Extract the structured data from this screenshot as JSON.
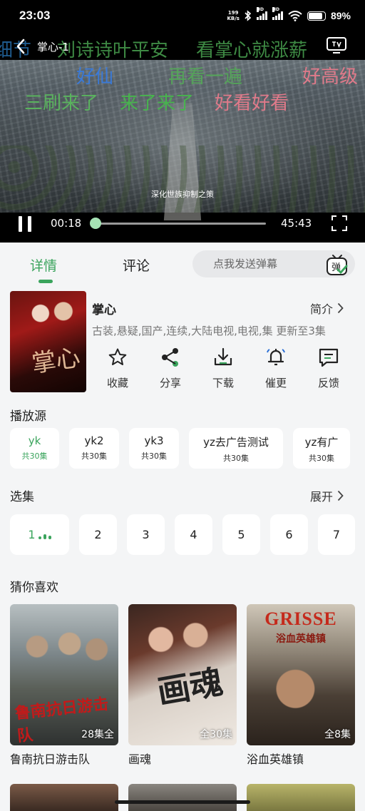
{
  "status_bar": {
    "time": "23:03",
    "net_speed_value": "199",
    "net_speed_unit": "KB/s",
    "hd1": "HD",
    "hd2": "HD",
    "battery": "89%"
  },
  "player": {
    "title": "掌心-1",
    "current_time": "00:18",
    "duration": "45:43",
    "progress": 0.0066,
    "caption": "深化世族抑制之策",
    "danmaku": [
      {
        "text": "细节",
        "color": "#1f5c8f"
      },
      {
        "text": "刘诗诗叶平安",
        "color": "#3e8a44"
      },
      {
        "text": "看掌心就涨薪",
        "color": "#3e8a44"
      },
      {
        "text": "好仙",
        "color": "#3a7ad8"
      },
      {
        "text": "再看一遍",
        "color": "#55a35a"
      },
      {
        "text": "好高级",
        "color": "#e07a8a"
      },
      {
        "text": "三刷来了",
        "color": "#5ab35e"
      },
      {
        "text": "来了来了",
        "color": "#48b34e"
      },
      {
        "text": "好看好看",
        "color": "#e07a8a"
      }
    ]
  },
  "tabs": {
    "details": "详情",
    "comments": "评论",
    "danmu_placeholder": "点我发送弹幕",
    "danmu_button": "弹"
  },
  "show": {
    "title": "掌心",
    "poster_text": "掌心",
    "intro": "简介",
    "tags": "古装,悬疑,国产,连续,大陆电视,电视,集 更新至3集"
  },
  "actions": {
    "favorite": "收藏",
    "share": "分享",
    "download": "下载",
    "remind": "催更",
    "feedback": "反馈"
  },
  "sources": {
    "heading": "播放源",
    "items": [
      {
        "name": "yk",
        "count": "共30集"
      },
      {
        "name": "yk2",
        "count": "共30集"
      },
      {
        "name": "yk3",
        "count": "共30集"
      },
      {
        "name": "yz去广告测试",
        "count": "共30集"
      },
      {
        "name": "yz有广",
        "count": "共30集"
      }
    ]
  },
  "episodes": {
    "heading": "选集",
    "expand": "展开",
    "items": [
      "1",
      "2",
      "3",
      "4",
      "5",
      "6",
      "7"
    ]
  },
  "recommend": {
    "heading": "猜你喜欢",
    "items": [
      {
        "name": "鲁南抗日游击队",
        "badge": "28集全",
        "poster_text": "鲁南抗日游击队"
      },
      {
        "name": "画魂",
        "badge": "全30集",
        "poster_text": "画魂"
      },
      {
        "name": "浴血英雄镇",
        "badge": "全8集",
        "poster_text_1": "GRISSE",
        "poster_text_2": "浴血英雄镇"
      }
    ]
  },
  "colors": {
    "accent": "#3aa45c",
    "page_bg": "#f4f5f6",
    "card_bg": "#ffffff"
  }
}
